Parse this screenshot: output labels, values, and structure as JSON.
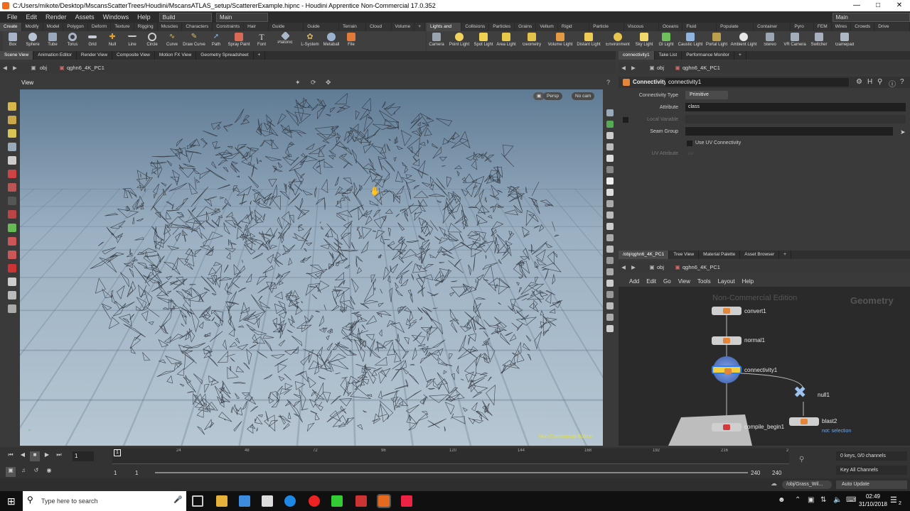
{
  "window": {
    "title": "C:/Users/mikote/Desktop/MscansScatterTrees/Houdini/MscansATLAS_setup/ScattererExample.hipnc - Houdini Apprentice Non-Commercial 17.0.352"
  },
  "menubar": {
    "items": [
      "File",
      "Edit",
      "Render",
      "Assets",
      "Windows",
      "Help"
    ],
    "desktop_left": "Build",
    "desktop_center": "Main",
    "desktop_right": "Main"
  },
  "shelf_left": {
    "tabs": [
      "Create",
      "Modify",
      "Model",
      "Polygon",
      "Deform",
      "Texture",
      "Rigging",
      "Muscles",
      "Characters",
      "Constraints",
      "Hair Utils",
      "Guide Process",
      "Guide Brushes",
      "Terrain FX",
      "Cloud FX",
      "Volume"
    ],
    "tools": [
      "Box",
      "Sphere",
      "Tube",
      "Torus",
      "Grid",
      "Null",
      "Line",
      "Circle",
      "Curve",
      "Draw Curve",
      "Path",
      "Spray Paint",
      "Font",
      "Platonic Solids",
      "L-System",
      "Metaball",
      "File"
    ]
  },
  "shelf_right": {
    "tabs": [
      "Lights and C...",
      "Collisions",
      "Particles",
      "Grains",
      "Vellum",
      "Rigid Bodies",
      "Particle Fluids",
      "Viscous Fluids",
      "Oceans",
      "Fluid Contai...",
      "Populate Con...",
      "Container Tools",
      "Pyro FX",
      "FEM",
      "Wires",
      "Crowds",
      "Drive Simula..."
    ],
    "tools": [
      "Camera",
      "Point Light",
      "Spot Light",
      "Area Light",
      "Geometry Light",
      "Volume Light",
      "Distant Light",
      "Environment Light",
      "Sky Light",
      "GI Light",
      "Caustic Light",
      "Portal Light",
      "Ambient Light",
      "Stereo Camera",
      "VR Camera",
      "Switcher",
      "Gamepad Camera"
    ]
  },
  "left_pane": {
    "tabs": [
      "Scene View",
      "Animation Editor",
      "Render View",
      "Composite View",
      "Motion FX View",
      "Geometry Spreadsheet"
    ],
    "path_obj": "obj",
    "path_node": "qghn6_4K_PC1",
    "view_label": "View",
    "persp_label": "Persp",
    "cam_label": "No cam",
    "watermark": "Non-Commercial Edition"
  },
  "parm_pane": {
    "tabs": [
      "connectivity1",
      "Take List",
      "Performance Monitor"
    ],
    "path_obj": "obj",
    "path_node": "qghn6_4K_PC1",
    "node_type": "Connectivity",
    "node_name": "connectivity1",
    "params": {
      "connectivity_type_label": "Connectivity Type",
      "connectivity_type_value": "Primitive",
      "attribute_label": "Attribute",
      "attribute_value": "class",
      "local_variable_label": "Local Variable",
      "seam_group_label": "Seam Group",
      "use_uv_label": "Use UV Connectivity",
      "uv_attribute_label": "UV Attribute",
      "uv_attribute_value": "uv"
    }
  },
  "network_pane": {
    "tabs": [
      "/obj/qghn6_4K_PC1",
      "Tree View",
      "Material Palette",
      "Asset Browser"
    ],
    "path_obj": "obj",
    "path_node": "qghn6_4K_PC1",
    "menu": [
      "Add",
      "Edit",
      "Go",
      "View",
      "Tools",
      "Layout",
      "Help"
    ],
    "watermark": "Non-Commercial Edition",
    "context_label": "Geometry",
    "nodes": {
      "convert": "convert1",
      "normal": "normal1",
      "connectivity": "connectivity1",
      "null": "null1",
      "blast": "blast2",
      "blast_sub": "not: selection",
      "compile": "compile_begin1"
    }
  },
  "timeline": {
    "frame": "1",
    "ticks": [
      "24",
      "48",
      "72",
      "96",
      "120",
      "144",
      "168",
      "192",
      "216",
      "2"
    ],
    "range_start": "1",
    "range_start2": "1",
    "range_end": "240",
    "range_end2": "240",
    "keys_info": "0 keys, 0/0 channels",
    "channels_btn": "Key All Channels",
    "status_path": "/obj/Grass_Wil...",
    "auto_update": "Auto Update"
  },
  "taskbar": {
    "search_placeholder": "Type here to search",
    "time": "02:49",
    "date": "31/10/2018",
    "notification_count": "2"
  }
}
